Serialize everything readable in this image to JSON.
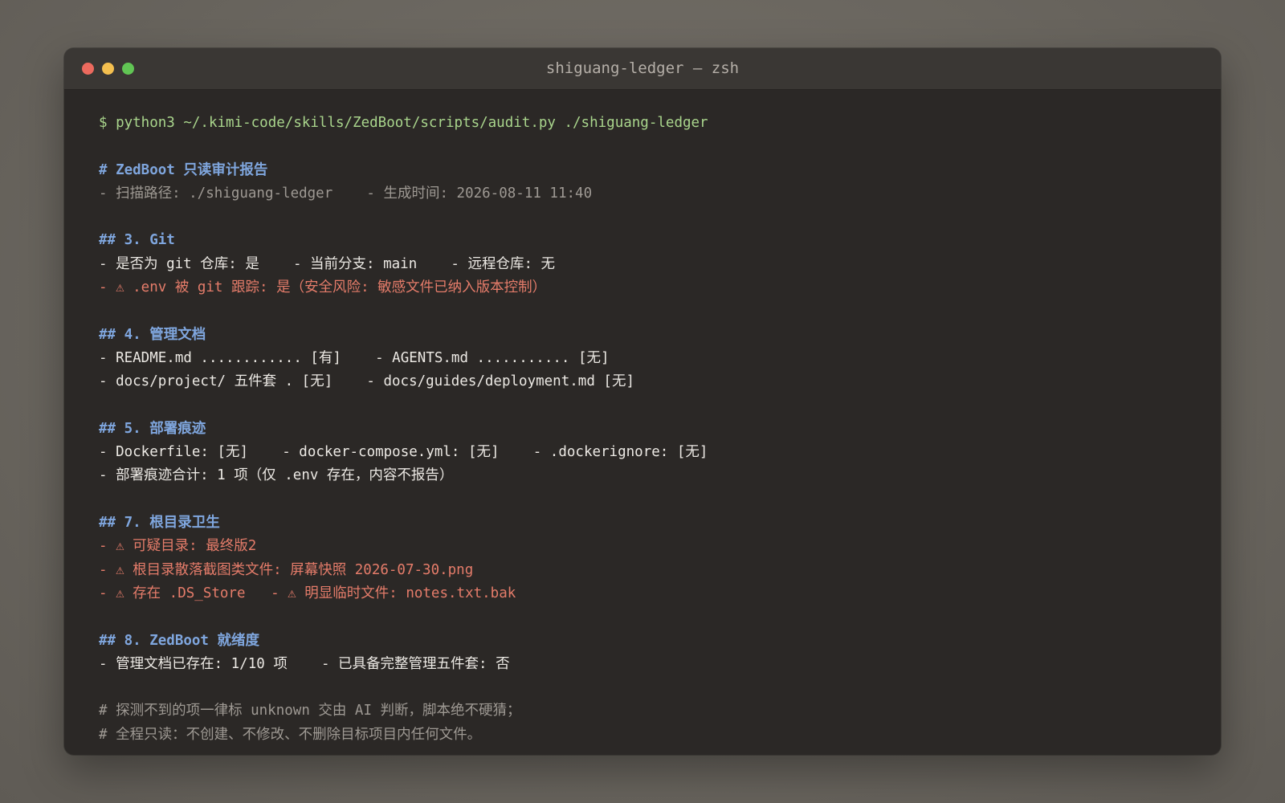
{
  "window": {
    "title": "shiguang-ledger — zsh"
  },
  "terminal": {
    "command": "$ python3 ~/.kimi-code/skills/ZedBoot/scripts/audit.py ./shiguang-ledger",
    "report_title": "# ZedBoot 只读审计报告",
    "meta_line": "- 扫描路径: ./shiguang-ledger    - 生成时间: 2026-08-11 11:40",
    "sections": {
      "git": {
        "heading": "## 3. Git",
        "line1": "- 是否为 git 仓库: 是    - 当前分支: main    - 远程仓库: 无",
        "warn1": "- ⚠ .env 被 git 跟踪: 是（安全风险: 敏感文件已纳入版本控制）"
      },
      "docs": {
        "heading": "## 4. 管理文档",
        "line1": "- README.md ............ [有]    - AGENTS.md ........... [无]",
        "line2": "- docs/project/ 五件套 . [无]    - docs/guides/deployment.md [无]"
      },
      "deploy": {
        "heading": "## 5. 部署痕迹",
        "line1": "- Dockerfile: [无]    - docker-compose.yml: [无]    - .dockerignore: [无]",
        "line2": "- 部署痕迹合计: 1 项（仅 .env 存在，内容不报告）"
      },
      "hygiene": {
        "heading": "## 7. 根目录卫生",
        "warn1": "- ⚠ 可疑目录: 最终版2",
        "warn2": "- ⚠ 根目录散落截图类文件: 屏幕快照 2026-07-30.png",
        "warn3": "- ⚠ 存在 .DS_Store   - ⚠ 明显临时文件: notes.txt.bak"
      },
      "readiness": {
        "heading": "## 8. ZedBoot 就绪度",
        "line1": "- 管理文档已存在: 1/10 项    - 已具备完整管理五件套: 否"
      }
    },
    "footer": {
      "comment1": "# 探测不到的项一律标 unknown 交由 AI 判断，脚本绝不硬猜；",
      "comment2": "# 全程只读：不创建、不修改、不删除目标项目内任何文件。"
    }
  },
  "colors": {
    "command": "#a9d58c",
    "heading": "#7fa6de",
    "warning": "#e57c6a",
    "muted": "#9e9993",
    "text": "#ece9e4",
    "background": "#2b2826"
  }
}
